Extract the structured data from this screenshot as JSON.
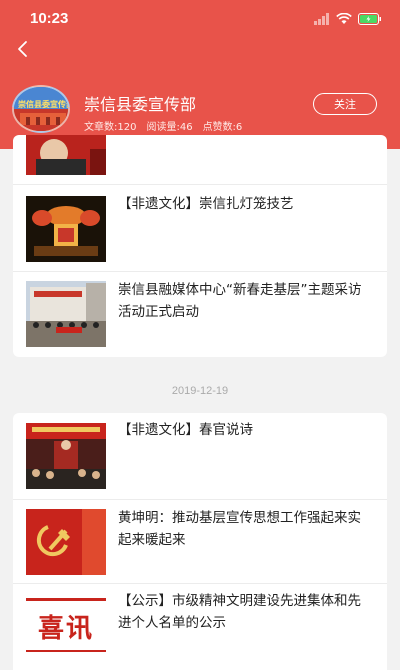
{
  "status_bar": {
    "time": "10:23"
  },
  "account": {
    "name": "崇信县委宣传部",
    "avatar_text": "崇信县委宣传部",
    "stats": {
      "articles": "文章数:120",
      "reads": "阅读量:46",
      "likes": "点赞数:6"
    },
    "follow_label": "关注"
  },
  "group1": {
    "items": [
      {
        "title": ""
      },
      {
        "title": "【非遗文化】崇信扎灯笼技艺"
      },
      {
        "title": "崇信县融媒体中心“新春走基层”主题采访活动正式启动"
      }
    ]
  },
  "group2": {
    "date": "2019-12-19",
    "items": [
      {
        "title": "【非遗文化】春官说诗"
      },
      {
        "title": "黄坤明：推动基层宣传思想工作强起来实起来暖起来"
      },
      {
        "title": "【公示】市级精神文明建设先进集体和先进个人名单的公示",
        "thumb_text": "喜讯"
      }
    ]
  },
  "colors": {
    "header": "#e8534a",
    "accent_red": "#c8241c"
  }
}
